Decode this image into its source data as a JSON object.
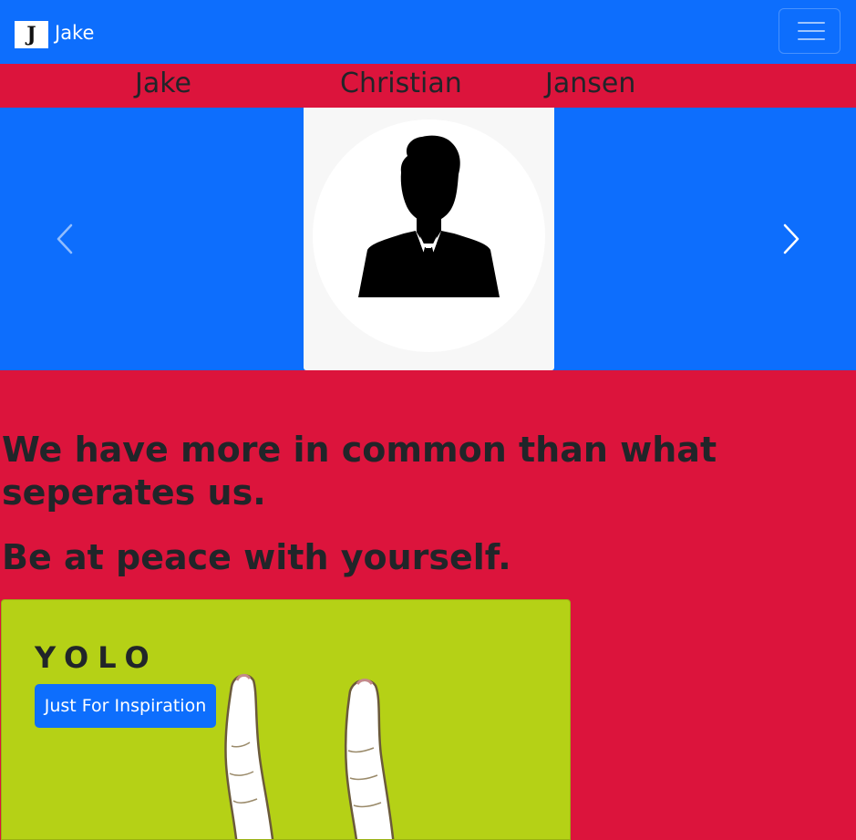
{
  "navbar": {
    "brand_logo_letter": "J",
    "brand_text": "Jake",
    "toggler_icon": "hamburger-menu-icon"
  },
  "names": [
    "Jake",
    "Christian",
    "Jansen"
  ],
  "carousel": {
    "image": "person-silhouette-avatar",
    "prev_icon": "chevron-left-icon",
    "next_icon": "chevron-right-icon"
  },
  "quotes": {
    "line1": "We have more in common than what seperates us.",
    "line2": "Be at peace with yourself."
  },
  "card": {
    "title": "YOLO",
    "button_label": "Just For Inspiration",
    "image": "peace-sign-hand-illustration"
  },
  "colors": {
    "primary": "#0d6efd",
    "crimson": "#dc143c",
    "card_lime": "#b5d116",
    "text_dark": "#212529"
  }
}
